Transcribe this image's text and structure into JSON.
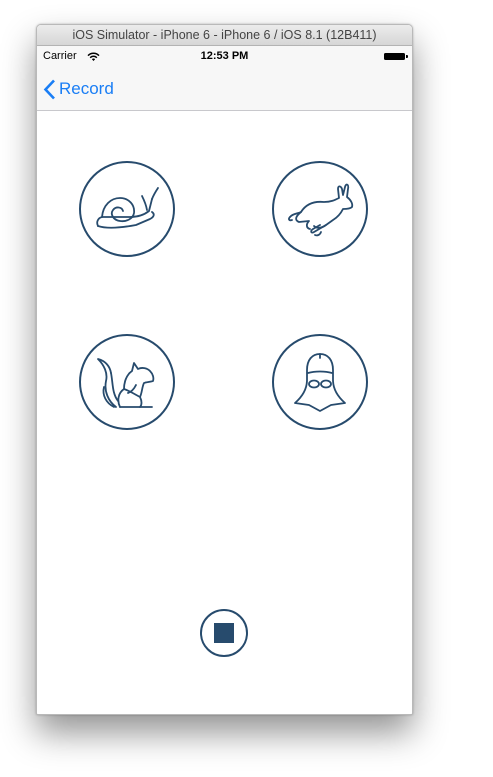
{
  "window": {
    "title": "iOS Simulator - iPhone 6 - iPhone 6 / iOS 8.1 (12B411)"
  },
  "status_bar": {
    "carrier": "Carrier",
    "time": "12:53 PM"
  },
  "nav": {
    "back_label": "Record"
  },
  "effects": [
    {
      "name": "snail",
      "icon": "snail-icon"
    },
    {
      "name": "rabbit",
      "icon": "rabbit-icon"
    },
    {
      "name": "squirrel",
      "icon": "squirrel-icon"
    },
    {
      "name": "darth-vader",
      "icon": "darth-vader-icon"
    }
  ],
  "colors": {
    "accent": "#274b6d",
    "tint": "#1a7ef5"
  }
}
